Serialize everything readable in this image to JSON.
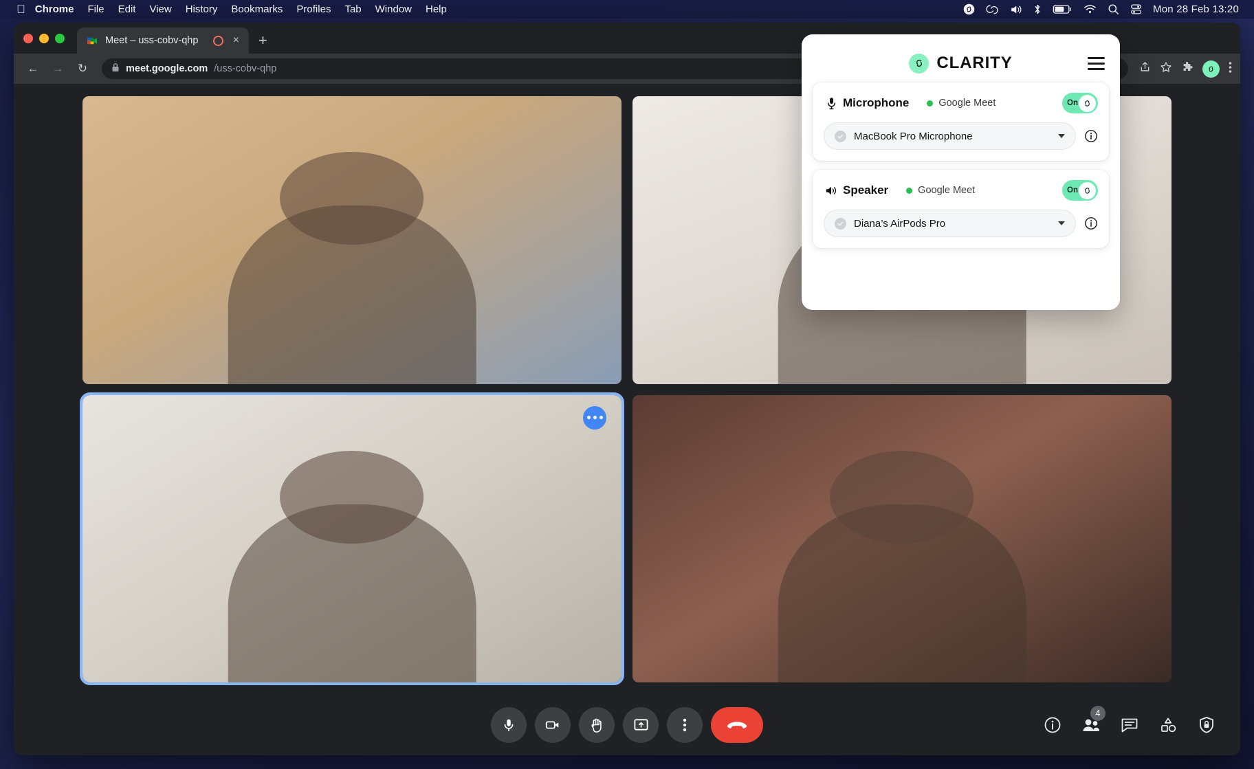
{
  "menubar": {
    "apple_icon": "apple-icon",
    "items": [
      {
        "label": "Chrome",
        "bold": true
      },
      {
        "label": "File",
        "bold": false
      },
      {
        "label": "Edit",
        "bold": false
      },
      {
        "label": "View",
        "bold": false
      },
      {
        "label": "History",
        "bold": false
      },
      {
        "label": "Bookmarks",
        "bold": false
      },
      {
        "label": "Profiles",
        "bold": false
      },
      {
        "label": "Tab",
        "bold": false
      },
      {
        "label": "Window",
        "bold": false
      },
      {
        "label": "Help",
        "bold": false
      }
    ],
    "status_icons": [
      "clarity-s-icon",
      "creative-cloud-icon",
      "volume-icon",
      "bluetooth-icon",
      "battery-icon",
      "wifi-icon",
      "spotlight-search-icon",
      "control-center-icon"
    ],
    "clock": "Mon 28 Feb  13:20"
  },
  "browser": {
    "tab": {
      "title": "Meet – uss-cobv-qhp",
      "favicon": "google-meet-icon",
      "recording_indicator": "recording-icon",
      "close_label": "×"
    },
    "new_tab_label": "+",
    "nav": {
      "back": "←",
      "forward": "→",
      "reload": "↻"
    },
    "omnibox": {
      "lock_icon": "lock-icon",
      "host": "meet.google.com",
      "path": "/uss-cobv-qhp"
    },
    "toolbar_right_icons": [
      "share-icon",
      "bookmark-star-icon",
      "extensions-puzzle-icon",
      "clarity-extension-icon",
      "chrome-menu-icon"
    ]
  },
  "meet": {
    "tiles": [
      {
        "name": "participant-tile-1",
        "active": false,
        "has_more_button": false
      },
      {
        "name": "participant-tile-2",
        "active": false,
        "has_more_button": false
      },
      {
        "name": "participant-tile-3",
        "active": true,
        "has_more_button": true
      },
      {
        "name": "participant-tile-4",
        "active": false,
        "has_more_button": false
      }
    ],
    "controls": [
      {
        "name": "microphone-button",
        "icon": "microphone-icon"
      },
      {
        "name": "camera-button",
        "icon": "video-camera-icon"
      },
      {
        "name": "raise-hand-button",
        "icon": "raised-hand-icon"
      },
      {
        "name": "present-screen-button",
        "icon": "present-screen-icon"
      },
      {
        "name": "more-options-button",
        "icon": "kebab-menu-icon"
      },
      {
        "name": "leave-call-button",
        "icon": "hang-up-icon"
      }
    ],
    "right_controls": [
      {
        "name": "meeting-details-button",
        "icon": "info-icon",
        "badge": ""
      },
      {
        "name": "participants-button",
        "icon": "people-icon",
        "badge": "4"
      },
      {
        "name": "chat-button",
        "icon": "chat-icon",
        "badge": ""
      },
      {
        "name": "activities-button",
        "icon": "activities-icon",
        "badge": ""
      },
      {
        "name": "host-controls-button",
        "icon": "shield-lock-icon",
        "badge": ""
      }
    ]
  },
  "clarity": {
    "brand": {
      "name": "CLARITY",
      "logo": "clarity-s-logo"
    },
    "menu_icon": "hamburger-menu-icon",
    "accent_green": "#6fe9b4",
    "status_green": "#2bbf4e",
    "sections": [
      {
        "name": "microphone",
        "icon": "microphone-icon",
        "title": "Microphone",
        "source": "Google Meet",
        "toggle_label": "On",
        "toggle_on": true,
        "device": "MacBook Pro Microphone",
        "device_status_icon": "check-circle-icon",
        "dropdown_icon": "chevron-down-icon",
        "info_icon": "info-circle-icon"
      },
      {
        "name": "speaker",
        "icon": "speaker-icon",
        "title": "Speaker",
        "source": "Google Meet",
        "toggle_label": "On",
        "toggle_on": true,
        "device": "Diana’s AirPods Pro",
        "device_status_icon": "check-circle-icon",
        "dropdown_icon": "chevron-down-icon",
        "info_icon": "info-circle-icon"
      }
    ]
  }
}
